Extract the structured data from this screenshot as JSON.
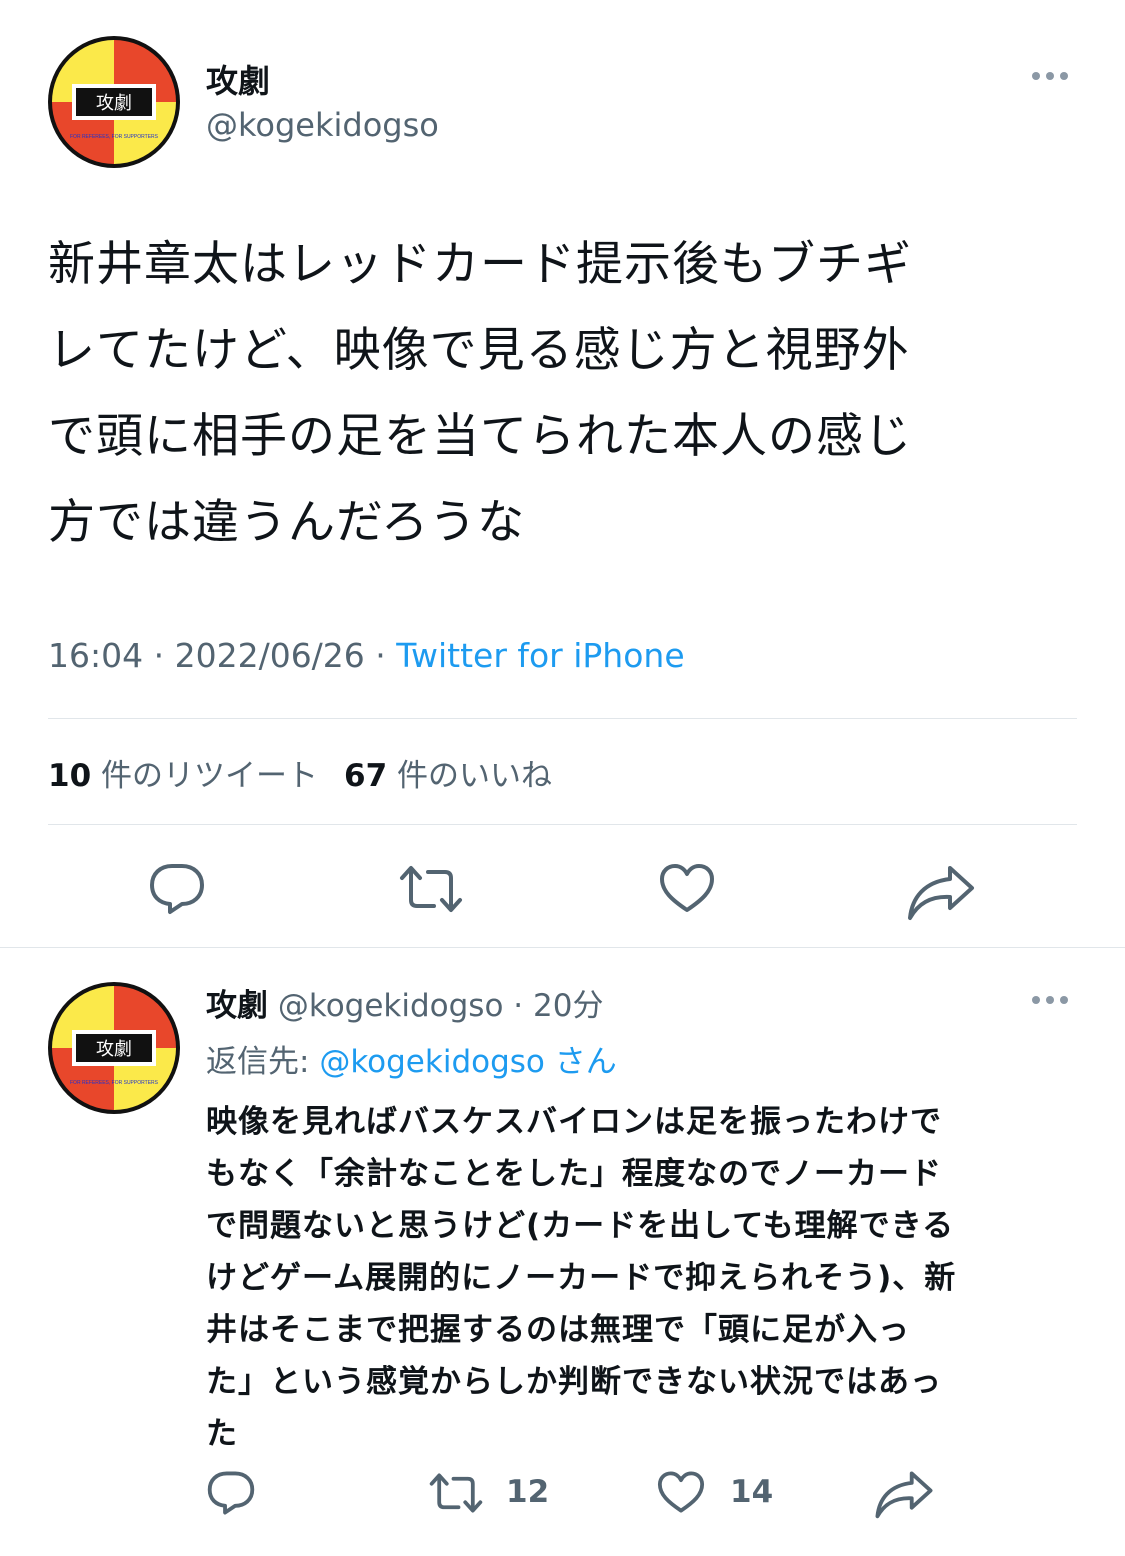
{
  "main_tweet": {
    "display_name": "攻劇",
    "handle": "@kogekidogso",
    "avatar_text": "攻劇",
    "avatar_subtext": "FOR REFEREES, FOR SUPPORTERS",
    "text_lines": [
      "新井章太はレッドカード提示後もブチギ",
      "レてたけど、映像で見る感じ方と視野外",
      "で頭に相手の足を当てられた本人の感じ",
      "方では違うんだろうな"
    ],
    "time": "16:04",
    "date": "2022/06/26",
    "separator": " · ",
    "source": "Twitter for iPhone",
    "retweets_count": "10",
    "retweets_label": "件のリツイート",
    "likes_count": "67",
    "likes_label": "件のいいね"
  },
  "reply_tweet": {
    "display_name": "攻劇",
    "handle": "@kogekidogso",
    "separator": " · ",
    "age": "20分",
    "replying_label": "返信先:",
    "replying_to": "@kogekidogso",
    "replying_suffix": "さん",
    "text_lines": [
      "映像を見ればバスケスバイロンは足を振ったわけで",
      "もなく「余計なことをした」程度なのでノーカード",
      "で問題ないと思うけど(カードを出しても理解できる",
      "けどゲーム展開的にノーカードで抑えられそう)、新",
      "井はそこまで把握するのは無理で「頭に足が入っ",
      "た」という感覚からしか判断できない状況ではあっ",
      "た"
    ],
    "retweets_count": "12",
    "likes_count": "14"
  },
  "icons": {
    "reply": "reply-icon",
    "retweet": "retweet-icon",
    "like": "heart-icon",
    "share": "share-icon",
    "more": "more-icon"
  },
  "colors": {
    "text": "#0f1419",
    "secondary": "#536471",
    "link": "#1d9bf0",
    "avatar_red": "#e8472b",
    "avatar_yellow": "#fbe94a"
  }
}
